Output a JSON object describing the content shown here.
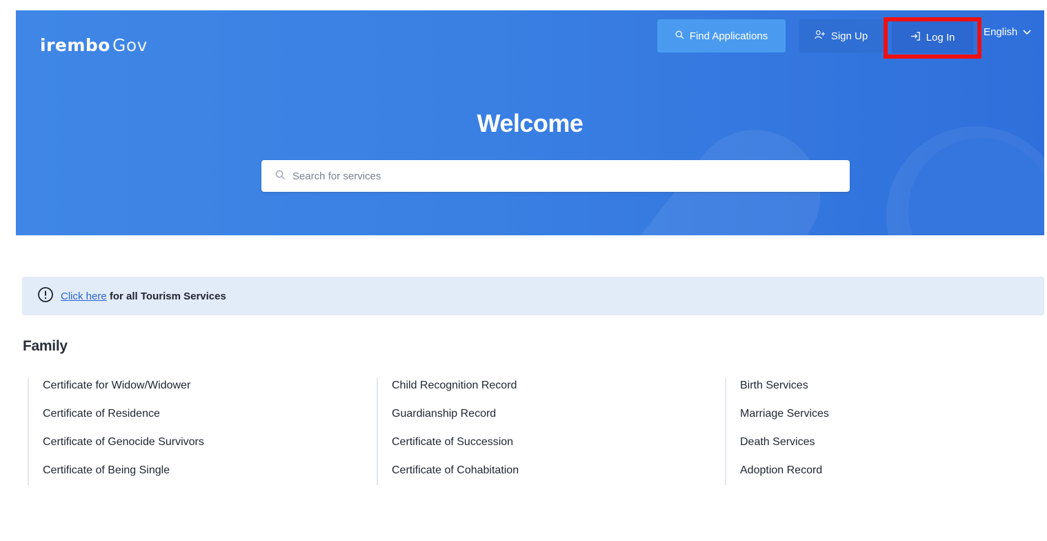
{
  "header": {
    "logo_brand": "irembo",
    "logo_suffix": "Gov",
    "find_applications_label": "Find Applications",
    "signup_label": "Sign Up",
    "login_label": "Log In",
    "language": "English"
  },
  "hero": {
    "title": "Welcome",
    "search_placeholder": "Search for services"
  },
  "notice": {
    "link_text": "Click here",
    "text": "for all Tourism Services"
  },
  "family": {
    "title": "Family",
    "columns": [
      [
        "Certificate for Widow/Widower",
        "Certificate of Residence",
        "Certificate of Genocide Survivors",
        "Certificate of Being Single"
      ],
      [
        "Child Recognition Record",
        "Guardianship Record",
        "Certificate of Succession",
        "Certificate of Cohabitation"
      ],
      [
        "Birth Services",
        "Marriage Services",
        "Death Services",
        "Adoption Record"
      ]
    ]
  },
  "colors": {
    "hero_blue": "#3a80e3",
    "highlight_red": "#ee1010",
    "notice_bg": "#e2ecf8",
    "link_blue": "#2a63d6"
  },
  "icons": {
    "find": "search-icon",
    "signup": "user-plus-icon",
    "login": "login-arrow-icon",
    "language": "chevron-down-icon",
    "search": "search-icon",
    "notice": "info-circle-icon"
  }
}
